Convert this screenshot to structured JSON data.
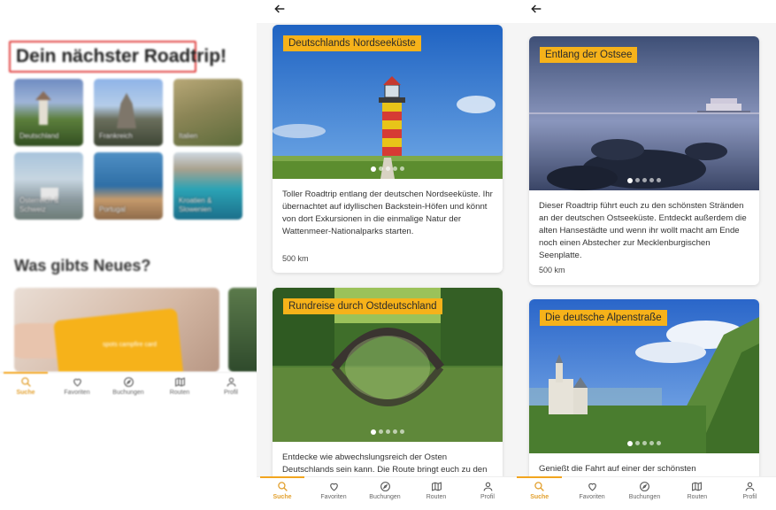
{
  "home": {
    "roadtrip_title": "Dein nächster Roadtrip!",
    "countries": [
      "Deutschland",
      "Frankreich",
      "Italien",
      "Österreich & Schweiz",
      "Portugal",
      "Kroatien & Slowenien"
    ],
    "news_title": "Was gibts Neues?",
    "news_card_text": "spots campfire card"
  },
  "nav": {
    "items": [
      {
        "label": "Suche",
        "icon": "search-icon"
      },
      {
        "label": "Favoriten",
        "icon": "heart-icon"
      },
      {
        "label": "Buchungen",
        "icon": "compass-icon"
      },
      {
        "label": "Routen",
        "icon": "map-icon"
      },
      {
        "label": "Profil",
        "icon": "user-icon"
      }
    ],
    "active": "Suche"
  },
  "trips_de": [
    {
      "title": "Deutschlands Nordseeküste",
      "description": "Toller Roadtrip entlang der deutschen Nordseeküste. Ihr übernachtet auf idyllischen Backstein-Höfen und könnt von dort Exkursionen in die einmalige Natur der Wattenmeer-Nationalparks starten.",
      "distance": "500 km"
    },
    {
      "title": "Rundreise durch Ostdeutschland",
      "description": "Entdecke wie abwechslungsreich der Osten Deutschlands sein kann. Die Route bringt euch zu den wunderschönen"
    }
  ],
  "trips_de2": [
    {
      "title": "Entlang der Ostsee",
      "description": "Dieser Roadtrip führt euch zu den schönsten Stränden an der deutschen Ostseeküste. Entdeckt außerdem die alten Hansestädte und wenn ihr wollt macht am Ende noch einen Abstecher zur Mecklenburgischen Seenplatte.",
      "distance": "500 km"
    },
    {
      "title": "Die deutsche Alpenstraße",
      "description": "Genießt die Fahrt auf einer der schönsten"
    }
  ]
}
